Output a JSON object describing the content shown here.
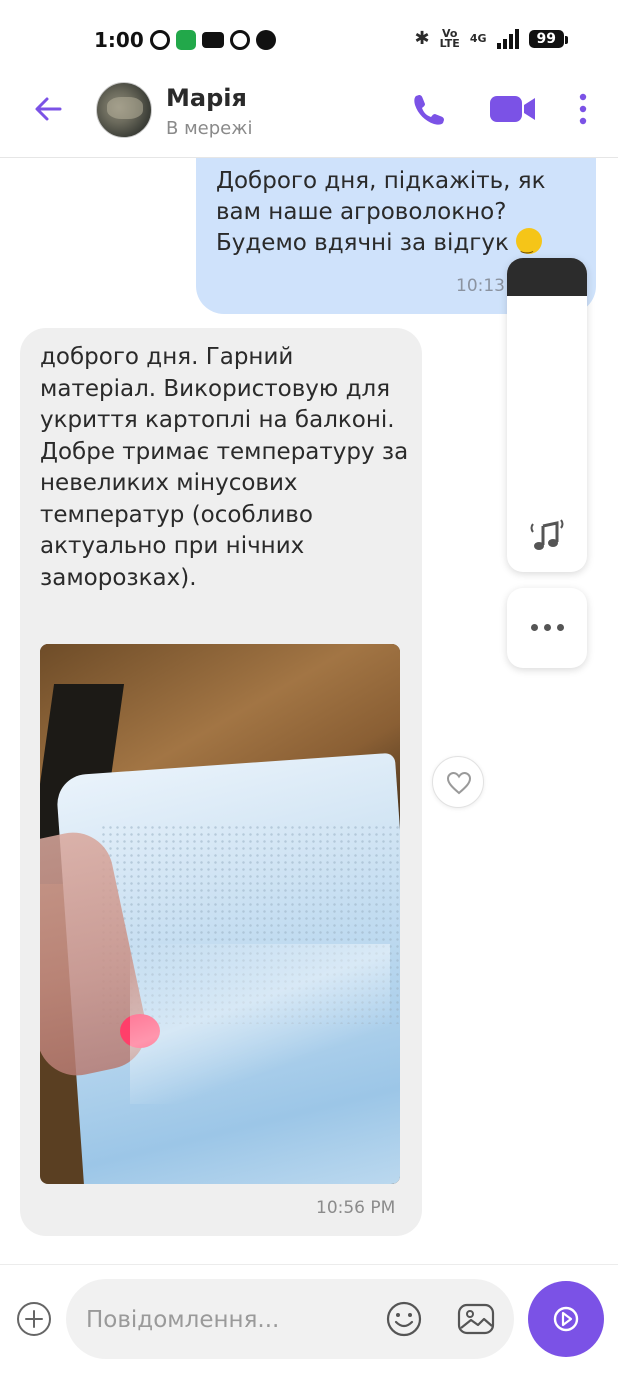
{
  "status_bar": {
    "time": "1:00",
    "volte_top": "Vo",
    "volte_bottom": "LTE",
    "network": "4G",
    "battery": "99"
  },
  "header": {
    "contact_name": "Марія",
    "contact_status": "В мережі"
  },
  "messages": {
    "outgoing": {
      "text": "Доброго дня, підкажіть, як вам наше агроволокно? Будемо вдячні за відгук",
      "time": "10:13"
    },
    "incoming": {
      "text": "доброго дня. Гарний матеріал. Використовую для укриття картоплі на балконі. Добре тримає температуру за невеликих мінусових температур (особливо актуально при нічних заморозках).",
      "time": "10:56 PM"
    }
  },
  "composer": {
    "placeholder": "Повідомлення..."
  },
  "colors": {
    "accent": "#7b52e6",
    "outgoing_bubble": "#cfe2fb",
    "incoming_bubble": "#efefef"
  },
  "icons": {
    "back": "arrow-left-icon",
    "call": "phone-icon",
    "video": "video-camera-icon",
    "more": "more-vertical-icon",
    "like": "heart-icon",
    "add": "plus-circle-icon",
    "emoji": "smiley-icon",
    "gallery": "gallery-icon",
    "send": "play-send-icon",
    "music": "music-note-icon"
  }
}
